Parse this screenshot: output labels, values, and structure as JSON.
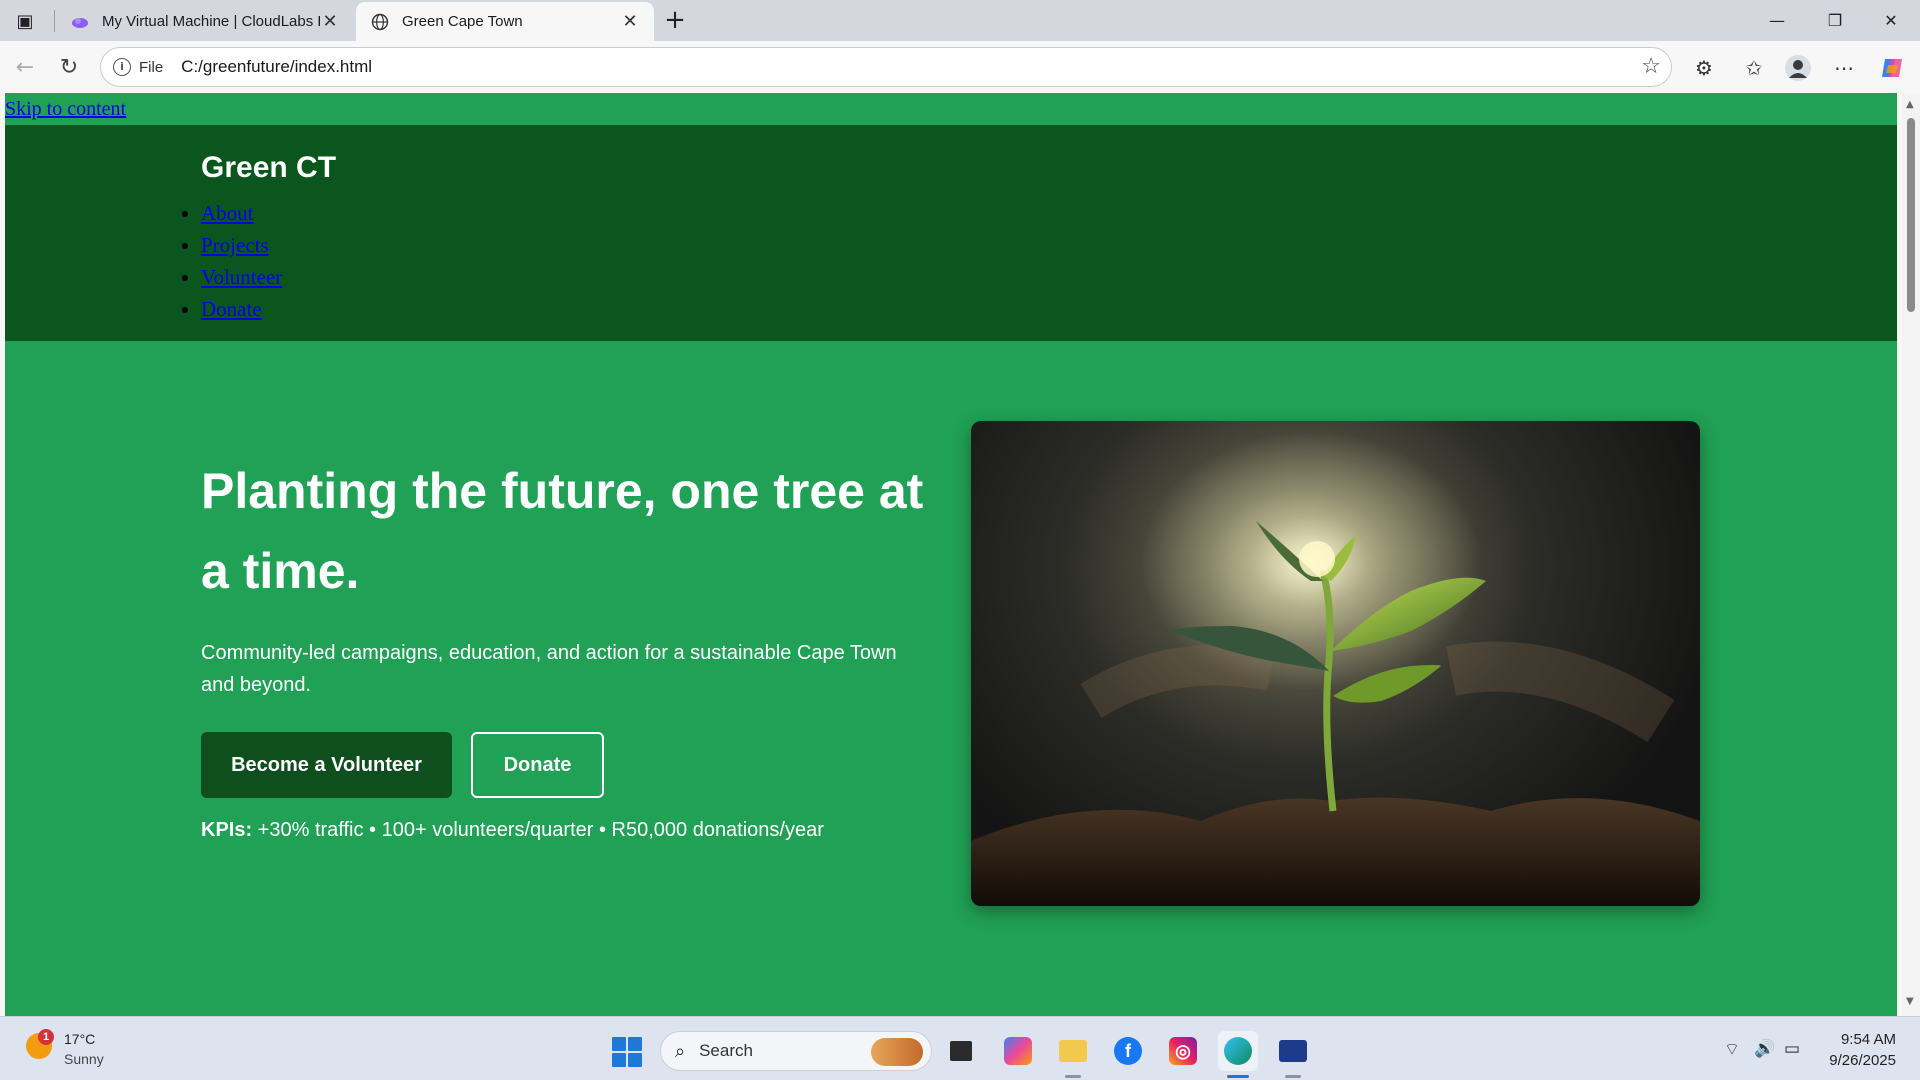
{
  "browser": {
    "tabs": [
      {
        "title": "My Virtual Machine | CloudLabs P",
        "active": false,
        "close": "✕"
      },
      {
        "title": "Green Cape Town",
        "active": true,
        "close": "✕"
      }
    ],
    "new_tab": "+",
    "omnibox": {
      "scheme": "File",
      "url": "C:/greenfuture/index.html"
    }
  },
  "page": {
    "skip_link": "Skip to content",
    "brand": "Green CT",
    "nav": [
      "About",
      "Projects",
      "Volunteer",
      "Donate"
    ],
    "hero": {
      "title": "Planting the future, one tree at a time.",
      "subtitle": "Community-led campaigns, education, and action for a sustainable Cape Town and beyond.",
      "primary_cta": "Become a Volunteer",
      "secondary_cta": "Donate",
      "kpi_label": "KPIs:",
      "kpi_text": " +30% traffic • 100+ volunteers/quarter • R50,000 donations/year"
    },
    "colors": {
      "header": "#0a561e",
      "hero_bg": "#21a155",
      "primary_btn": "#0f4f1d"
    }
  },
  "taskbar": {
    "weather": {
      "badge": "1",
      "temp": "17°C",
      "condition": "Sunny"
    },
    "search_placeholder": "Search",
    "clock": {
      "time": "9:54 AM",
      "date": "9/26/2025"
    }
  }
}
